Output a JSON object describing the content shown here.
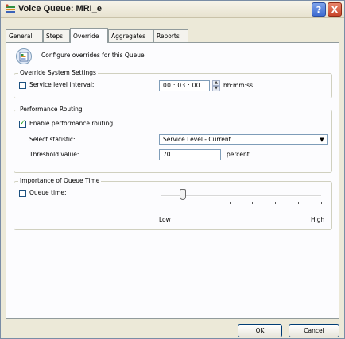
{
  "window": {
    "title": "Voice Queue: MRI_e",
    "help_label": "?",
    "close_label": "X"
  },
  "tabs": [
    {
      "label": "General",
      "active": false
    },
    {
      "label": "Steps",
      "active": false
    },
    {
      "label": "Override",
      "active": true
    },
    {
      "label": "Aggregates",
      "active": false
    },
    {
      "label": "Reports",
      "active": false
    }
  ],
  "header": {
    "text": "Configure overrides for this Queue"
  },
  "override_settings": {
    "title": "Override System Settings",
    "service_level_label": "Service level interval:",
    "service_level_checked": false,
    "interval_value": "00 : 03 : 00",
    "interval_unit": "hh:mm:ss"
  },
  "performance_routing": {
    "title": "Performance Routing",
    "enable_label": "Enable performance routing",
    "enable_checked": true,
    "statistic_label": "Select statistic:",
    "statistic_value": "Service Level - Current",
    "threshold_label": "Threshold value:",
    "threshold_value": "70",
    "threshold_unit": "percent"
  },
  "queue_time": {
    "title": "Importance of Queue Time",
    "checkbox_label": "Queue time:",
    "checked": false,
    "low_label": "Low",
    "high_label": "High",
    "slider_level": 0.14
  },
  "footer": {
    "ok_label": "OK",
    "cancel_label": "Cancel"
  },
  "colors": {
    "titlebar_bg": "#ece9d8",
    "checkmark": "#21a121",
    "help_button": "#3d6ad0",
    "close_button": "#c8452a"
  }
}
